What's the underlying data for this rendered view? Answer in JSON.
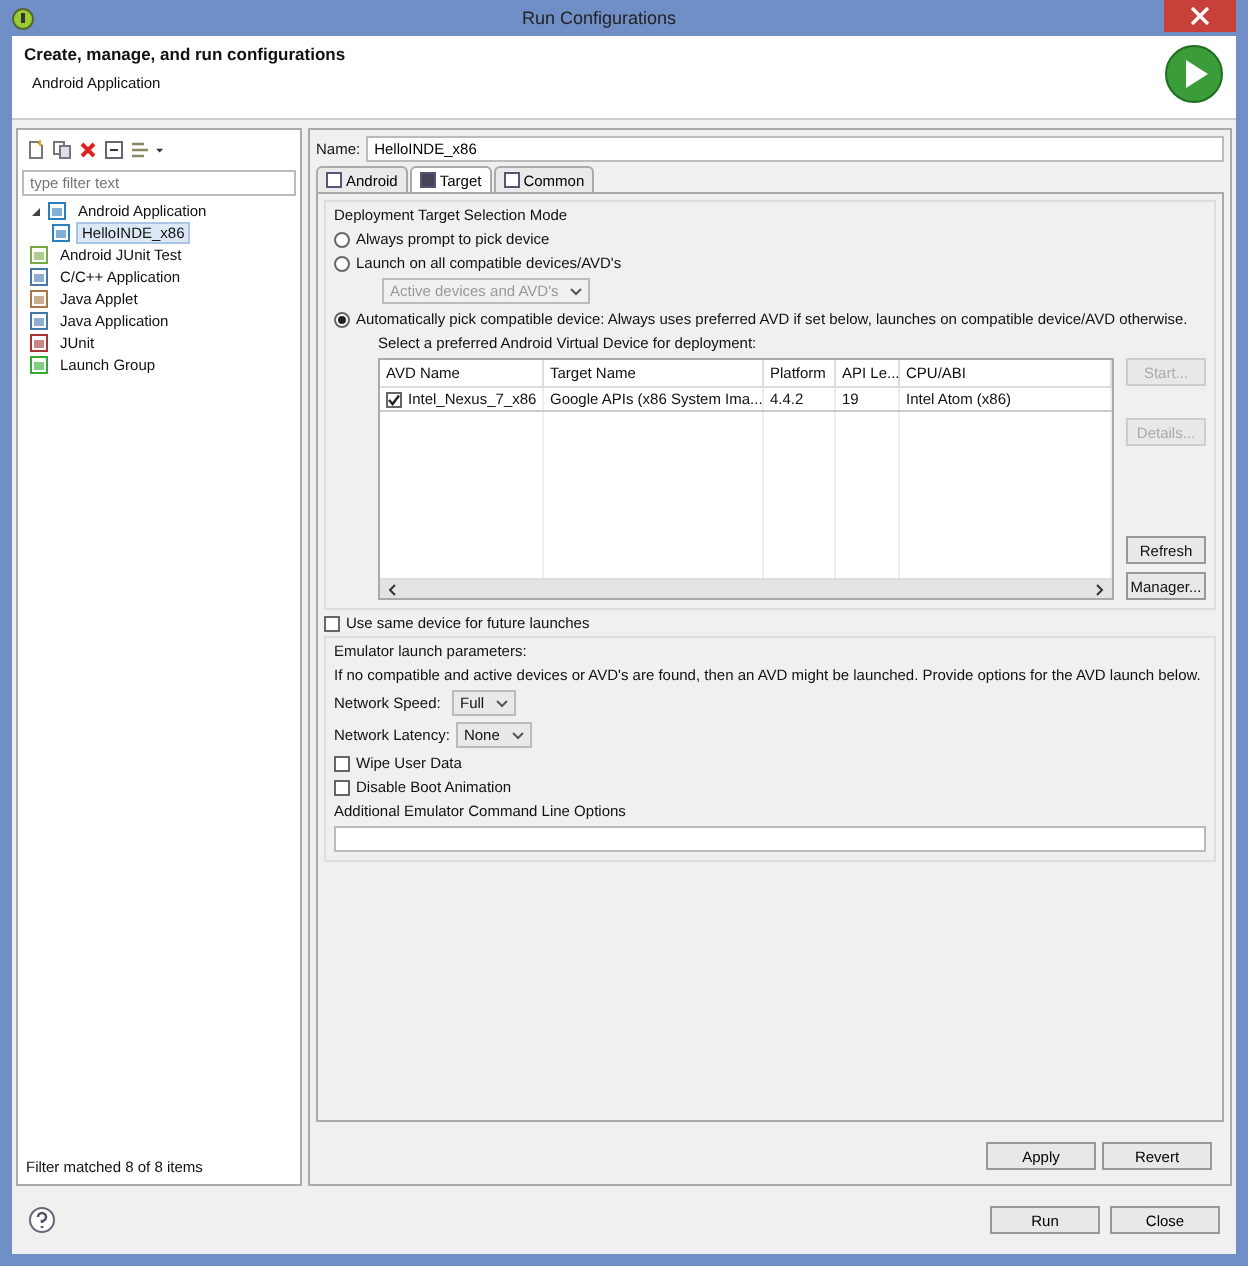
{
  "window": {
    "title": "Run Configurations"
  },
  "header": {
    "title": "Create, manage, and run configurations",
    "subtitle": "Android Application"
  },
  "sidebar": {
    "filter": {
      "placeholder": "type filter text"
    },
    "tree": [
      {
        "label": "Android Application",
        "expanded": true,
        "selected": false,
        "children": [
          {
            "label": "HelloINDE_x86",
            "selected": true
          }
        ]
      },
      {
        "label": "Android JUnit Test",
        "selected": false
      },
      {
        "label": "C/C++ Application",
        "selected": false
      },
      {
        "label": "Java Applet",
        "selected": false
      },
      {
        "label": "Java Application",
        "selected": false
      },
      {
        "label": "JUnit",
        "selected": false
      },
      {
        "label": "Launch Group",
        "selected": false
      }
    ],
    "status": "Filter matched 8 of 8 items"
  },
  "name_field": {
    "label": "Name:",
    "value": "HelloINDE_x86"
  },
  "tabs": [
    {
      "label": "Android",
      "selected": false
    },
    {
      "label": "Target",
      "selected": true
    },
    {
      "label": "Common",
      "selected": false
    }
  ],
  "deployment": {
    "title": "Deployment Target Selection Mode",
    "options": [
      {
        "label": "Always prompt to pick device",
        "selected": false
      },
      {
        "label": "Launch on all compatible devices/AVD's",
        "selected": false
      },
      {
        "label": "Automatically pick compatible device: Always uses preferred AVD if set below, launches on compatible device/AVD otherwise.",
        "selected": true
      }
    ],
    "device_dropdown": {
      "value": "Active devices and AVD's",
      "disabled": true
    },
    "avd_prompt": "Select a preferred Android Virtual Device for deployment:",
    "table": {
      "columns": [
        "AVD Name",
        "Target Name",
        "Platform",
        "API Le...",
        "CPU/ABI"
      ],
      "rows": [
        {
          "checked": true,
          "cells": [
            "Intel_Nexus_7_x86",
            "Google APIs (x86 System Ima...",
            "4.4.2",
            "19",
            "Intel Atom (x86)"
          ]
        }
      ]
    },
    "buttons": [
      {
        "label": "Start...",
        "disabled": true
      },
      {
        "label": "Details...",
        "disabled": true
      },
      {
        "label": "Refresh",
        "disabled": false
      },
      {
        "label": "Manager...",
        "disabled": false
      }
    ],
    "same_device": {
      "label": "Use same device for future launches",
      "checked": false
    }
  },
  "emulator": {
    "title": "Emulator launch parameters:",
    "note": "If no compatible and active devices or AVD's are found, then an AVD might be launched. Provide options for the AVD launch below.",
    "selects": [
      {
        "label": "Network Speed:",
        "value": "Full"
      },
      {
        "label": "Network Latency:",
        "value": "None"
      }
    ],
    "checkboxes": [
      {
        "label": "Wipe User Data",
        "checked": false
      },
      {
        "label": "Disable Boot Animation",
        "checked": false
      }
    ],
    "options_label": "Additional Emulator Command Line Options"
  },
  "actions": [
    "Apply",
    "Revert"
  ],
  "footer_buttons": [
    "Run",
    "Close"
  ]
}
